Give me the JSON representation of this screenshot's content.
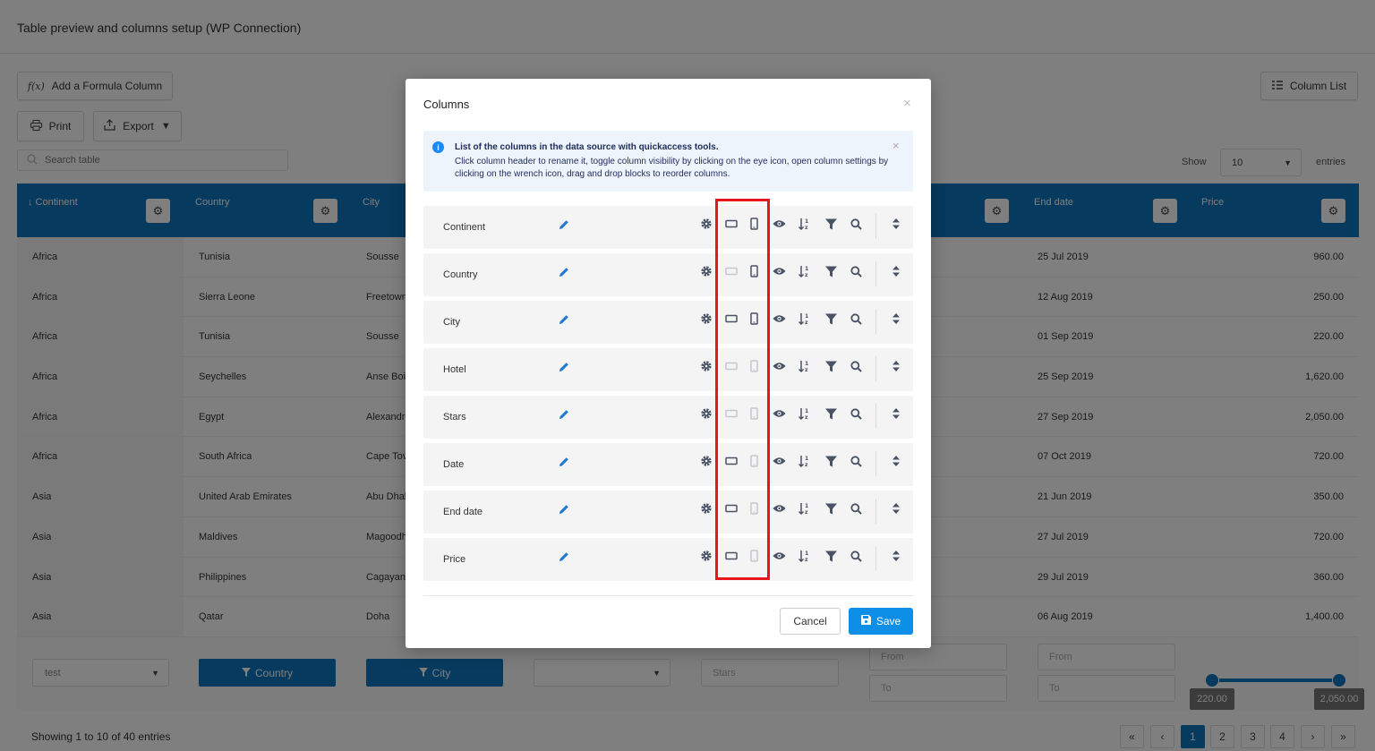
{
  "page": {
    "title": "Table preview and columns setup (WP Connection)",
    "formula_button": "Add a Formula Column",
    "formula_icon_text": "f(x)",
    "print_button": "Print",
    "export_button": "Export",
    "column_list_button": "Column List",
    "search_placeholder": "Search table",
    "show_label": "Show",
    "show_value": "10",
    "entries_label": "entries"
  },
  "table": {
    "headers": [
      {
        "label": "↓ Continent"
      },
      {
        "label": "Country"
      },
      {
        "label": "City"
      },
      {
        "label": ""
      },
      {
        "label": ""
      },
      {
        "label": ""
      },
      {
        "label": "End date"
      },
      {
        "label": "Price"
      }
    ],
    "rows": [
      {
        "continent": "Africa",
        "country": "Tunisia",
        "city": "Sousse",
        "end_date": "25 Jul 2019",
        "price": "960.00"
      },
      {
        "continent": "Africa",
        "country": "Sierra Leone",
        "city": "Freetown",
        "end_date": "12 Aug 2019",
        "price": "250.00"
      },
      {
        "continent": "Africa",
        "country": "Tunisia",
        "city": "Sousse",
        "end_date": "01 Sep 2019",
        "price": "220.00"
      },
      {
        "continent": "Africa",
        "country": "Seychelles",
        "city": "Anse Boi",
        "end_date": "25 Sep 2019",
        "price": "1,620.00"
      },
      {
        "continent": "Africa",
        "country": "Egypt",
        "city": "Alexandr",
        "end_date": "27 Sep 2019",
        "price": "2,050.00"
      },
      {
        "continent": "Africa",
        "country": "South Africa",
        "city": "Cape Tov",
        "end_date": "07 Oct 2019",
        "price": "720.00"
      },
      {
        "continent": "Asia",
        "country": "United Arab Emirates",
        "city": "Abu Dhab",
        "end_date": "21 Jun 2019",
        "price": "350.00"
      },
      {
        "continent": "Asia",
        "country": "Maldives",
        "city": "Magoodh",
        "end_date": "27 Jul 2019",
        "price": "720.00"
      },
      {
        "continent": "Asia",
        "country": "Philippines",
        "city": "Cagayan",
        "end_date": "29 Jul 2019",
        "price": "360.00"
      },
      {
        "continent": "Asia",
        "country": "Qatar",
        "city": "Doha",
        "end_date": "06 Aug 2019",
        "price": "1,400.00"
      }
    ],
    "filters": {
      "continent_select": "test",
      "country_button": "Country",
      "city_button": "City",
      "stars_placeholder": "Stars",
      "date_from": "From",
      "date_to": "To",
      "end_from": "From",
      "end_to": "To",
      "price_min": "220.00",
      "price_max": "2,050.00"
    },
    "info": "Showing 1 to 10 of 40 entries",
    "pagination": {
      "first": "«",
      "prev": "‹",
      "pages": [
        "1",
        "2",
        "3",
        "4"
      ],
      "next": "›",
      "last": "»",
      "current": "1"
    }
  },
  "modal": {
    "title": "Columns",
    "close": "×",
    "notice_title": "List of the columns in the data source with quickaccess tools.",
    "notice_text": "Click column header to rename it, toggle column visibility by clicking on the eye icon, open column settings by clicking on the wrench icon, drag and drop blocks to reorder columns.",
    "notice_close": "×",
    "columns": [
      {
        "name": "Continent",
        "tablet": true,
        "mobile": true
      },
      {
        "name": "Country",
        "tablet": false,
        "mobile": true
      },
      {
        "name": "City",
        "tablet": true,
        "mobile": true
      },
      {
        "name": "Hotel",
        "tablet": false,
        "mobile": false
      },
      {
        "name": "Stars",
        "tablet": false,
        "mobile": false
      },
      {
        "name": "Date",
        "tablet": true,
        "mobile": false
      },
      {
        "name": "End date",
        "tablet": true,
        "mobile": false
      },
      {
        "name": "Price",
        "tablet": true,
        "mobile": false
      }
    ],
    "cancel_label": "Cancel",
    "save_label": "Save"
  },
  "colors": {
    "primary": "#0d75bc",
    "save": "#0d8fe8",
    "highlight": "#e8151b",
    "icon_active": "#4a5266",
    "icon_inactive": "#c4c7cc"
  }
}
